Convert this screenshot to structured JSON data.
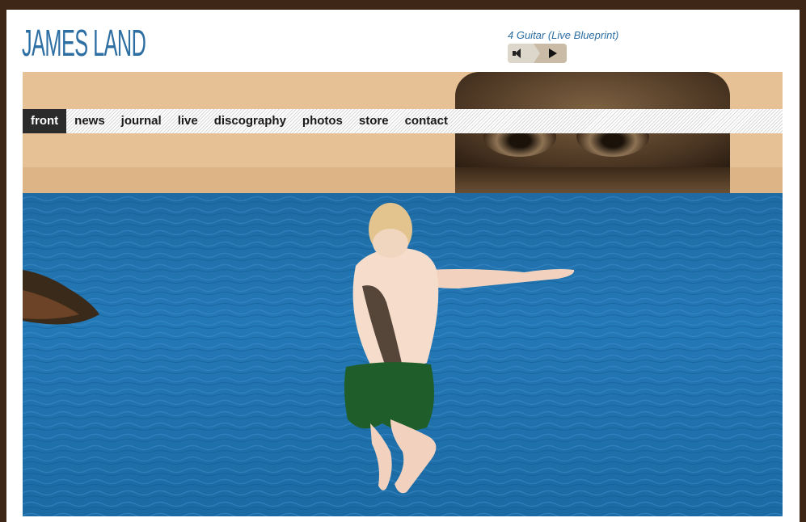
{
  "site": {
    "title": "JAMES LAND"
  },
  "player": {
    "track": "4 Guitar (Live Blueprint)",
    "volume_icon": "speaker-icon",
    "play_icon": "play-icon"
  },
  "nav": {
    "items": [
      {
        "label": "front",
        "active": true
      },
      {
        "label": "news"
      },
      {
        "label": "journal"
      },
      {
        "label": "live"
      },
      {
        "label": "discography"
      },
      {
        "label": "photos"
      },
      {
        "label": "store"
      },
      {
        "label": "contact"
      }
    ]
  },
  "colors": {
    "frame": "#3e2716",
    "brand": "#2e6fa3",
    "nav_active_bg": "#2b2b2b",
    "banner": "#e5c195",
    "sea": "#2379b6"
  }
}
